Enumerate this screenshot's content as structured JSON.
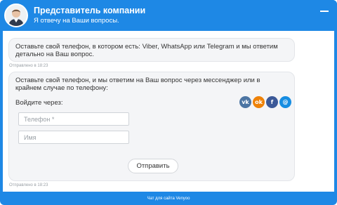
{
  "header": {
    "title": "Представитель компании",
    "subtitle": "Я отвечу на Ваши вопросы."
  },
  "messages": [
    {
      "text": "Оставьте свой телефон, в котором есть: Viber, WhatsApp или Telegram и мы ответим детально на Ваш вопрос.",
      "sent": "Отправлено в 18:23"
    },
    {
      "text": "Оставьте свой телефон, и мы ответим на Ваш вопрос через мессенджер или в крайнем случае по телефону:",
      "sent": "Отправлено в 18:23"
    }
  ],
  "form": {
    "login_label": "Войдите через:",
    "phone_placeholder": "Телефон *",
    "name_placeholder": "Имя",
    "send_label": "Отправить"
  },
  "socials": [
    {
      "name": "vk",
      "glyph": "vk",
      "color": "#4c75a3"
    },
    {
      "name": "ok",
      "glyph": "ok",
      "color": "#ee8208"
    },
    {
      "name": "facebook",
      "glyph": "f",
      "color": "#3b5998"
    },
    {
      "name": "mail",
      "glyph": "@",
      "color": "#168de2"
    }
  ],
  "footer": {
    "text": "Чат для сайта Venyoo"
  },
  "colors": {
    "brand": "#1e88e5",
    "bubble_bg": "#f4f5f7"
  }
}
